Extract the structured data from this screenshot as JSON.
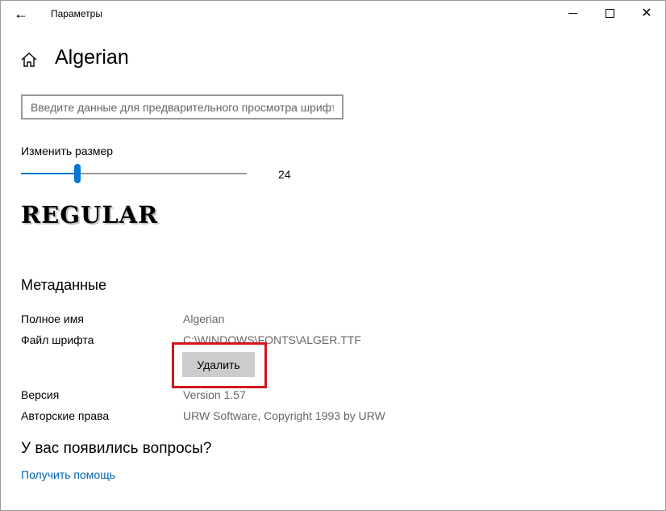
{
  "window": {
    "title": "Параметры",
    "back_icon": "arrow-left-icon",
    "controls": {
      "minimize_icon": "minimize-icon",
      "maximize_icon": "maximize-icon",
      "close_icon": "close-icon"
    }
  },
  "header": {
    "home_icon": "home-icon",
    "title": "Algerian"
  },
  "preview": {
    "placeholder": "Введите данные для предварительного просмотра шрифта",
    "value": ""
  },
  "size": {
    "label": "Изменить размер",
    "value": "24",
    "slider_fraction": 0.25
  },
  "sample": {
    "style_name": "REGULAR"
  },
  "metadata": {
    "heading": "Метаданные",
    "full_name_label": "Полное имя",
    "full_name_value": "Algerian",
    "file_label": "Файл шрифта",
    "file_value": "C:\\WINDOWS\\FONTS\\ALGER.TTF",
    "uninstall_label": "Удалить",
    "version_label": "Версия",
    "version_value": "Version 1.57",
    "copyright_label": "Авторские права",
    "copyright_value": "URW Software, Copyright 1993 by URW"
  },
  "help": {
    "heading": "У вас появились вопросы?",
    "link_label": "Получить помощь"
  },
  "colors": {
    "accent": "#0078d7",
    "link": "#0063b1",
    "highlight": "#d0161c",
    "button": "#cccccc"
  }
}
